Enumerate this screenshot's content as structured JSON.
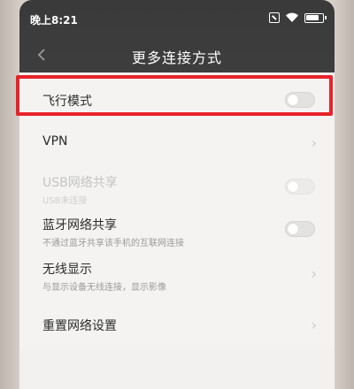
{
  "status_bar": {
    "time": "晚上8:21",
    "icons": [
      "sim-icon",
      "wifi-icon",
      "battery-icon"
    ]
  },
  "header": {
    "back_icon": "back-chevron-icon",
    "title": "更多连接方式"
  },
  "settings": [
    {
      "id": "airplane-mode",
      "title": "飞行模式",
      "subtitle": "",
      "control": "toggle",
      "enabled": true,
      "on": false
    },
    {
      "id": "vpn",
      "title": "VPN",
      "subtitle": "",
      "control": "chevron",
      "enabled": true
    },
    {
      "id": "usb-tethering",
      "title": "USB网络共享",
      "subtitle": "USB未连接",
      "control": "toggle",
      "enabled": false,
      "on": false
    },
    {
      "id": "bluetooth-tethering",
      "title": "蓝牙网络共享",
      "subtitle": "不通过蓝牙共享该手机的互联网连接",
      "control": "toggle",
      "enabled": true,
      "on": false
    },
    {
      "id": "wireless-display",
      "title": "无线显示",
      "subtitle": "与显示设备无线连接，显示影像",
      "control": "chevron",
      "enabled": true
    },
    {
      "id": "reset-network",
      "title": "重置网络设置",
      "subtitle": "",
      "control": "chevron",
      "enabled": true
    }
  ],
  "annotation": {
    "highlight_color": "#e8232a",
    "highlight_target": "airplane-mode"
  },
  "colors": {
    "header_bg": "#3a3a3a",
    "list_bg": "#f4f3f1"
  }
}
